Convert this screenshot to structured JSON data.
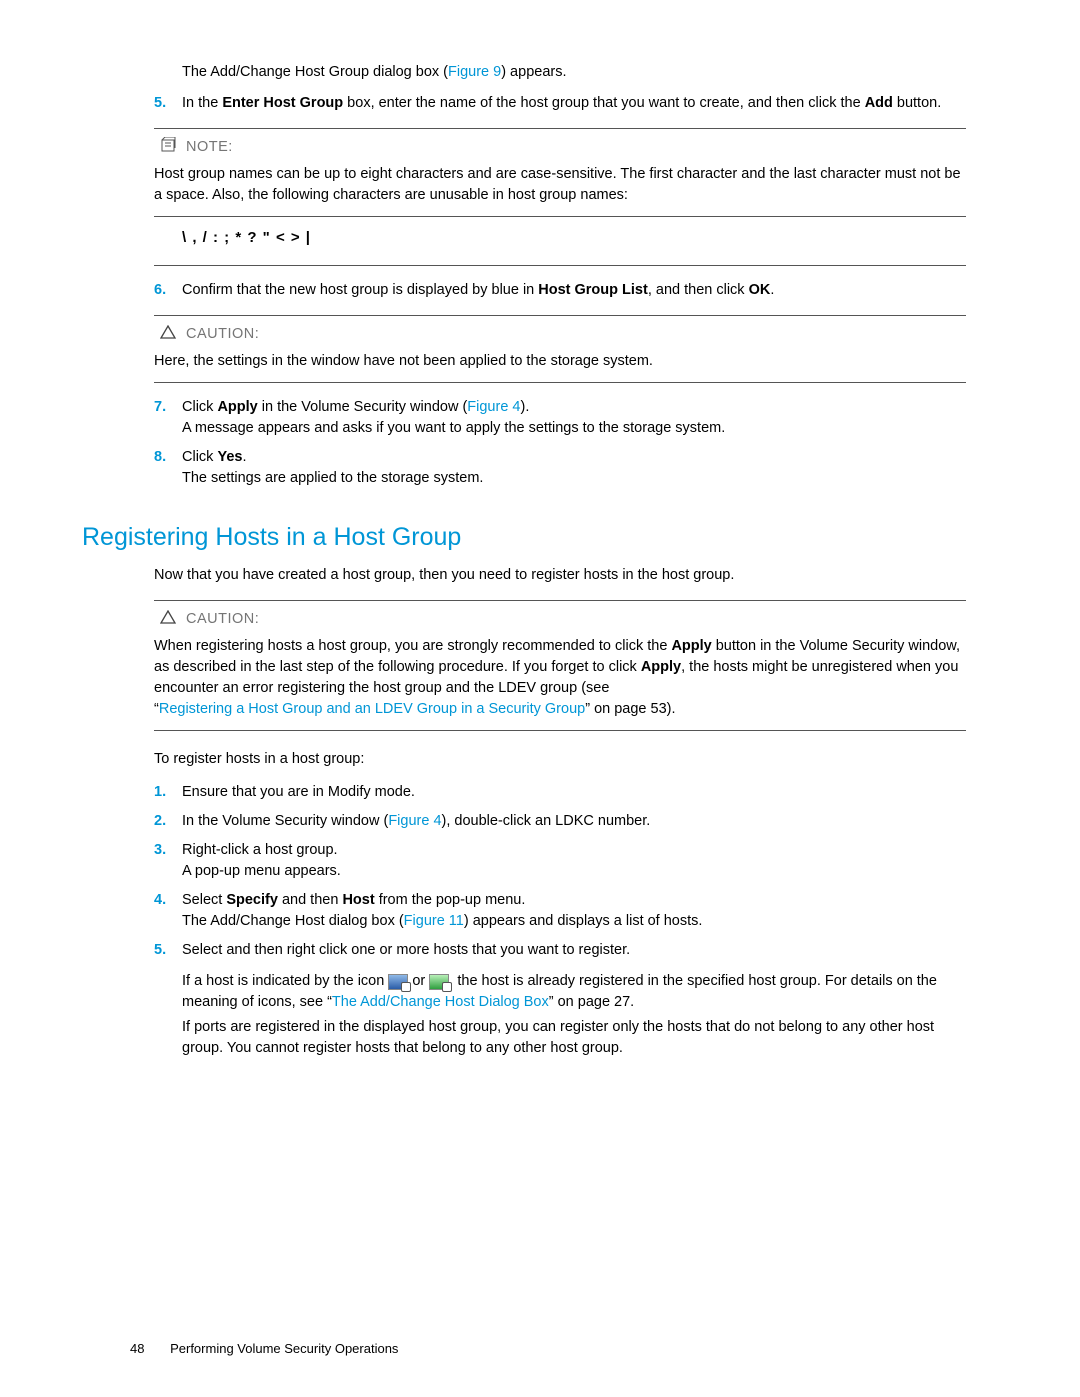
{
  "top": {
    "dialog_intro_pre": "The Add/Change Host Group dialog box (",
    "fig9": "Figure 9",
    "dialog_intro_post": ") appears."
  },
  "step5": {
    "num": "5.",
    "text_a": "In the ",
    "b1": "Enter Host Group",
    "text_b": " box, enter the name of the host group that you want to create, and then click the ",
    "b2": "Add",
    "text_c": " button."
  },
  "note1": {
    "title": "NOTE:",
    "body": "Host group names can be up to eight characters and are case-sensitive. The first character and the last character must not be a space. Also, the following characters are unusable in host group names:",
    "chars": "\\ , / : ; * ? \" < > |"
  },
  "step6": {
    "num": "6.",
    "text_a": "Confirm that the new host group is displayed by blue in ",
    "b1": "Host Group List",
    "text_b": ", and then click ",
    "b2": "OK",
    "text_c": "."
  },
  "caution1": {
    "title": "CAUTION:",
    "body": "Here, the settings in the window have not been applied to the storage system."
  },
  "step7": {
    "num": "7.",
    "text_a": "Click ",
    "b1": "Apply",
    "text_b": " in the Volume Security window (",
    "fig4": "Figure 4",
    "text_c": ").",
    "line2": "A message appears and asks if you want to apply the settings to the storage system."
  },
  "step8": {
    "num": "8.",
    "text_a": "Click ",
    "b1": "Yes",
    "text_b": ".",
    "line2": "The settings are applied to the storage system."
  },
  "section2": {
    "title": "Registering Hosts in a Host Group",
    "intro": "Now that you have created a host group, then you need to register hosts in the host group."
  },
  "caution2": {
    "title": "CAUTION:",
    "p1_a": "When registering hosts a host group, you are strongly recommended to click the ",
    "p1_b1": "Apply",
    "p1_b": " button in the Volume Security window, as described in the last step of the following procedure. If you forget to click ",
    "p1_b2": "Apply",
    "p1_c": ", the hosts might be unregistered when you encounter an error registering the host group and the LDEV group (see",
    "link": "Registering a Host Group and an LDEV Group in a Security Group",
    "p2_a": "“",
    "p2_b": "” on page 53)."
  },
  "intro2": "To register hosts in a host group:",
  "s2_1": {
    "num": "1.",
    "text": "Ensure that you are in Modify mode."
  },
  "s2_2": {
    "num": "2.",
    "text_a": "In the Volume Security window (",
    "fig4": "Figure 4",
    "text_b": "), double-click an LDKC number."
  },
  "s2_3": {
    "num": "3.",
    "text": "Right-click a host group.",
    "line2": "A pop-up menu appears."
  },
  "s2_4": {
    "num": "4.",
    "text_a": "Select ",
    "b1": "Specify",
    "text_b": " and then ",
    "b2": "Host",
    "text_c": " from the pop-up menu.",
    "line2_a": "The Add/Change Host dialog box (",
    "fig11": "Figure 11",
    "line2_b": ") appears and displays a list of hosts."
  },
  "s2_5": {
    "num": "5.",
    "text": "Select and then right click one or more hosts that you want to register.",
    "p2_a": "If a host is indicated by the icon ",
    "p2_b": " or ",
    "p2_c": ", the host is already registered in the specified host group. For details on the meaning of icons, see “",
    "link": "The Add/Change Host Dialog Box",
    "p2_d": "” on page 27.",
    "p3": "If ports are registered in the displayed host group, you can register only the hosts that do not belong to any other host group. You cannot register hosts that belong to any other host group."
  },
  "footer": {
    "page": "48",
    "title": "Performing Volume Security Operations"
  }
}
